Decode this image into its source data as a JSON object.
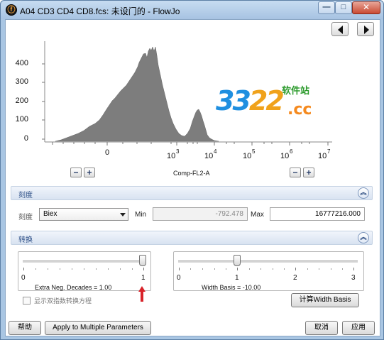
{
  "window": {
    "title": "A04 CD3 CD4 CD8.fcs: 未设门的 - FlowJo",
    "app_icon": "flowjo-logo-icon",
    "controls": {
      "minimize": "—",
      "maximize": "□",
      "close": "✕"
    }
  },
  "nav": {
    "prev_icon": "arrow-left-icon",
    "next_icon": "arrow-right-icon"
  },
  "histogram": {
    "y_ticks": [
      "400",
      "300",
      "200",
      "100",
      "0"
    ],
    "x_ticks": [
      {
        "base": "0",
        "exp": ""
      },
      {
        "base": "10",
        "exp": "3"
      },
      {
        "base": "10",
        "exp": "4"
      },
      {
        "base": "10",
        "exp": "5"
      },
      {
        "base": "10",
        "exp": "6"
      },
      {
        "base": "10",
        "exp": "7"
      }
    ],
    "x_axis_title": "Comp-FL2-A",
    "fill_color": "#7d7d7d",
    "zoom_minus": "−",
    "zoom_plus": "+"
  },
  "watermark": {
    "digits_a": "33",
    "digits_b": "22",
    "domain": ".cc",
    "chinese": "软件站"
  },
  "scale_section": {
    "header": "刻度",
    "scale_label": "刻度",
    "scale_value": "Biex",
    "min_label": "Min",
    "min_value": "-792.478",
    "max_label": "Max",
    "max_value": "16777216.000"
  },
  "transform_section": {
    "header": "转换",
    "neg_decades": {
      "labels": [
        "0",
        "1"
      ],
      "caption": "Extra Neg. Decades = 1.00",
      "value": 1.0
    },
    "width_basis": {
      "labels": [
        "0",
        "1",
        "2",
        "3"
      ],
      "caption": "Width Basis = -10.00",
      "value": 1.0
    },
    "show_equation_label": "显示双指数转换方程",
    "width_basis_button": "计算Width Basis"
  },
  "footer": {
    "help": "帮助",
    "apply_multiple": "Apply to Multiple Parameters",
    "cancel": "取消",
    "apply": "应用"
  },
  "colors": {
    "arrow": "#d8232a",
    "section_text": "#2d4f87"
  }
}
